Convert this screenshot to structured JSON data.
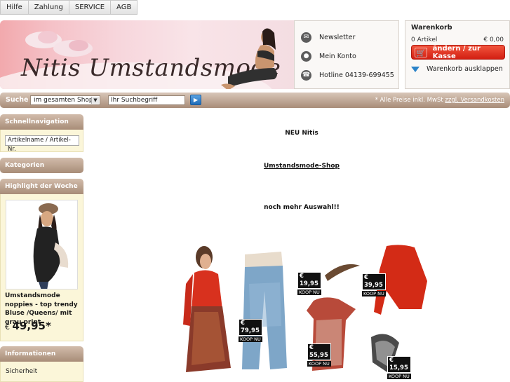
{
  "top_nav": [
    "Hilfe",
    "Zahlung",
    "SERVICE",
    "AGB"
  ],
  "header": {
    "logo_text": "Nitis Umstandsmode",
    "links": [
      {
        "icon": "envelope-icon",
        "label": "Newsletter"
      },
      {
        "icon": "user-icon",
        "label": "Mein Konto"
      },
      {
        "icon": "phone-icon",
        "label": "Hotline 04139-699455"
      }
    ]
  },
  "cart": {
    "title": "Warenkorb",
    "count": "0 Artikel",
    "total": "€ 0,00",
    "checkout_label": "ändern / zur Kasse",
    "expand_label": "Warenkorb ausklappen"
  },
  "search": {
    "label": "Suche",
    "scope": "im gesamten Shop",
    "input": "Ihr Suchbegriff",
    "prices_note": "* Alle Preise inkl. MwSt",
    "shipping_link": "zzgl. Versandkosten"
  },
  "sidebar": {
    "quicknav_title": "Schnellnavigation",
    "quicknav_input": "Artikelname / Artikel-Nr.",
    "categories_title": "Kategorien",
    "highlight_title": "Highlight der Woche",
    "product_name": "Umstandsmode noppies - top trendy Bluse /Queens/ mit grau print",
    "product_currency": "€",
    "product_price": "49,95",
    "product_price_suffix": "*",
    "info_title": "Informationen",
    "info_link": "Sicherheit"
  },
  "main": {
    "line1": "NEU Nitis",
    "line2": "Umstandsmode-Shop",
    "line3": "noch mehr Auswahl!!",
    "price_tags": [
      {
        "price": "€ 79,95",
        "koop": "KOOP NU"
      },
      {
        "price": "€ 19,95",
        "koop": "KOOP NU"
      },
      {
        "price": "€ 39,95",
        "koop": "KOOP NU"
      },
      {
        "price": "€ 55,95",
        "koop": "KOOP NU"
      },
      {
        "price": "€ 15,95",
        "koop": "KOOP NU"
      }
    ]
  },
  "colors": {
    "nav_brown": "#a88c78",
    "cart_red": "#d21f12",
    "sidebar_bg": "#fbf6d9",
    "search_button_blue": "#1f6cb7"
  }
}
